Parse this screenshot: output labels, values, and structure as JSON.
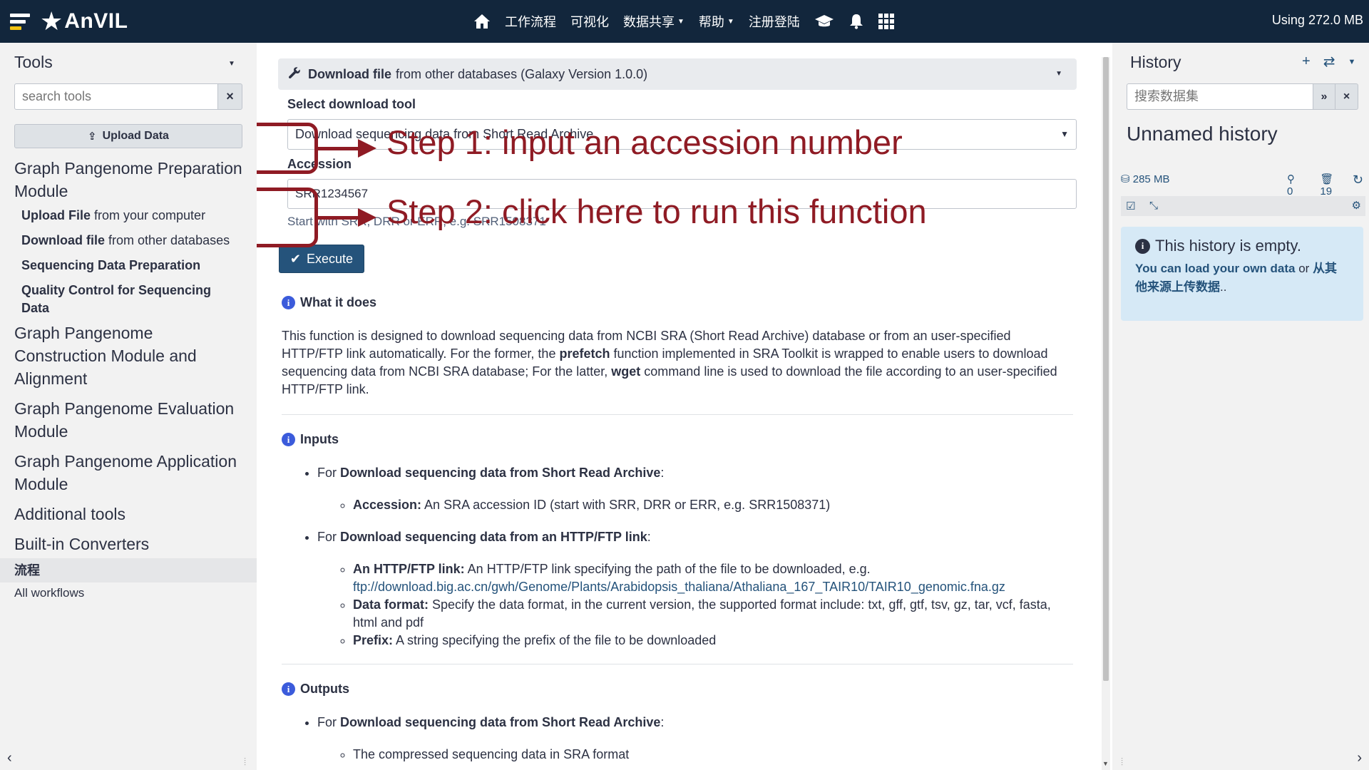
{
  "masthead": {
    "brand": "AnVIL",
    "nav": [
      {
        "label": "工作流程",
        "caret": false
      },
      {
        "label": "可视化",
        "caret": false
      },
      {
        "label": "数据共享",
        "caret": true
      },
      {
        "label": "帮助",
        "caret": true
      },
      {
        "label": "注册登陆",
        "caret": false
      }
    ],
    "quota": "Using 272.0 MB"
  },
  "tool_panel": {
    "title": "Tools",
    "search_placeholder": "search tools",
    "upload_label": "Upload Data",
    "sections": [
      {
        "title": "Graph Pangenome Preparation Module",
        "tools": [
          {
            "name": "Upload File",
            "desc": " from your computer"
          },
          {
            "name": "Download file",
            "desc": " from other databases"
          },
          {
            "name": "Sequencing Data Preparation",
            "desc": ""
          },
          {
            "name": "Quality Control for Sequencing Data",
            "desc": ""
          }
        ]
      },
      {
        "title": "Graph Pangenome Construction Module and Alignment",
        "tools": []
      },
      {
        "title": "Graph Pangenome Evaluation Module",
        "tools": []
      },
      {
        "title": "Graph Pangenome Application Module",
        "tools": []
      },
      {
        "title": "Additional tools",
        "tools": []
      },
      {
        "title": "Built-in Converters",
        "tools": []
      }
    ],
    "workflows_header": "流程",
    "workflows_link": "All workflows"
  },
  "tool_form": {
    "name": "Download file",
    "description": "from other databases (Galaxy Version 1.0.0)",
    "select_label": "Select download tool",
    "select_value": "Download sequencing data from Short Read Archive",
    "accession_label": "Accession",
    "accession_value": "SRR1234567",
    "accession_help": "Start with SRR, DRR or ERR, e.g. SRR1508371",
    "execute_label": "Execute"
  },
  "annotations": {
    "step1": "Step 1: input an accession number",
    "step2": "Step 2: click here to run this function",
    "color": "#8f1b24"
  },
  "help": {
    "what_title": "What it does",
    "what_text_1": "This function is designed to download sequencing data from NCBI SRA (Short Read Archive) database or from an user-specified HTTP/FTP link automatically. For the former, the ",
    "what_bold_1": "prefetch",
    "what_text_2": " function implemented in SRA Toolkit is wrapped to enable users to download sequencing data from NCBI SRA database; For the latter, ",
    "what_bold_2": "wget",
    "what_text_3": " command line is used to download the file according to an user-specified HTTP/FTP link.",
    "inputs_title": "Inputs",
    "for": "For ",
    "in_sra_title": "Download sequencing data from Short Read Archive",
    "in_acc_label": "Accession:",
    "in_acc_text": " An SRA accession ID (start with SRR, DRR or ERR, e.g. SRR1508371)",
    "in_http_title": "Download sequencing data from an HTTP/FTP link",
    "in_link_label": "An HTTP/FTP link:",
    "in_link_text": " An HTTP/FTP link specifying the path of the file to be downloaded, e.g.",
    "in_link_example": "ftp://download.big.ac.cn/gwh/Genome/Plants/Arabidopsis_thaliana/Athaliana_167_TAIR10/TAIR10_genomic.fna.gz",
    "in_format_label": "Data format:",
    "in_format_text": " Specify the data format, in the current version, the supported format include: txt, gff, gtf, tsv, gz, tar, vcf, fasta, html and pdf",
    "in_prefix_label": "Prefix:",
    "in_prefix_text": " A string specifying the prefix of the file to be downloaded",
    "outputs_title": "Outputs",
    "out_sra_title": "Download sequencing data from Short Read Archive",
    "out_sra_text": "The compressed sequencing data in SRA format"
  },
  "history": {
    "title": "History",
    "search_placeholder": "搜索数据集",
    "name": "Unnamed history",
    "size": "285 MB",
    "shown": "0",
    "deleted": "19",
    "empty_title": "This history is empty.",
    "empty_link": "You can load your own data",
    "empty_or": " or ",
    "empty_link2": "从其他来源上传数据",
    "empty_end": ".."
  },
  "colors": {
    "masthead": "#12263c",
    "primary": "#25537b",
    "panel": "#f2f2f2"
  }
}
